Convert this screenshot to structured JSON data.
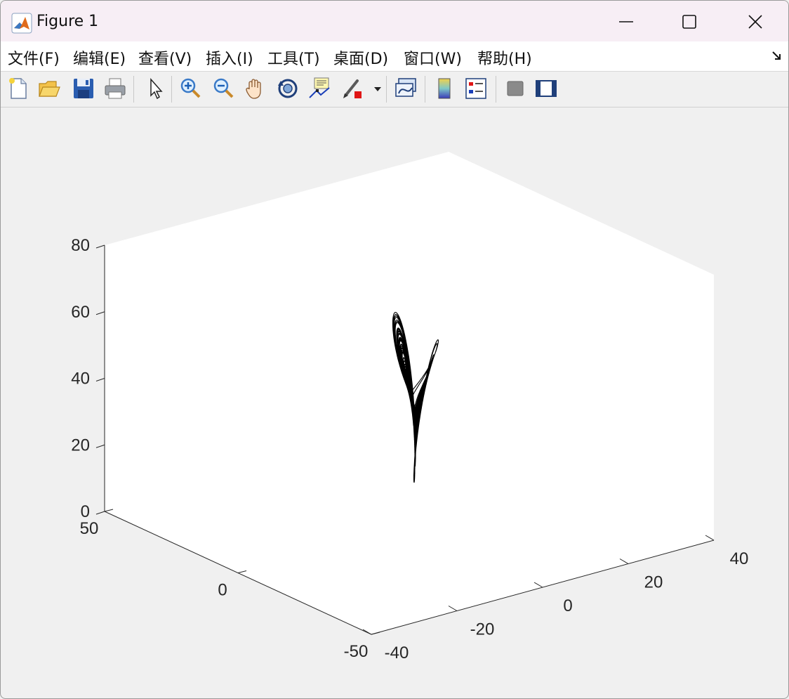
{
  "window": {
    "title": "Figure 1"
  },
  "menu": [
    "文件(F)",
    "编辑(E)",
    "查看(V)",
    "插入(I)",
    "工具(T)",
    "桌面(D)",
    "窗口(W)",
    "帮助(H)"
  ],
  "toolbar": [
    "new-figure-icon",
    "open-file-icon",
    "save-icon",
    "print-icon",
    "pointer-icon",
    "zoom-in-icon",
    "zoom-out-icon",
    "pan-icon",
    "rotate-3d-icon",
    "data-cursor-icon",
    "brush-icon",
    "link-plot-icon",
    "colorbar-icon",
    "legend-icon",
    "hide-plot-tools-icon",
    "show-plot-tools-icon"
  ],
  "chart_data": {
    "type": "line",
    "title": "",
    "plot_type": "3-D line (strange attractor trajectory)",
    "line_color": "#000000",
    "xlim": [
      -40,
      40
    ],
    "ylim": [
      -50,
      50
    ],
    "zlim": [
      0,
      80
    ],
    "x_ticks": [
      "-40",
      "-20",
      "0",
      "20",
      "40"
    ],
    "y_ticks": [
      "-50",
      "0",
      "50"
    ],
    "z_ticks": [
      "0",
      "20",
      "40",
      "60",
      "80"
    ],
    "grid": false
  }
}
